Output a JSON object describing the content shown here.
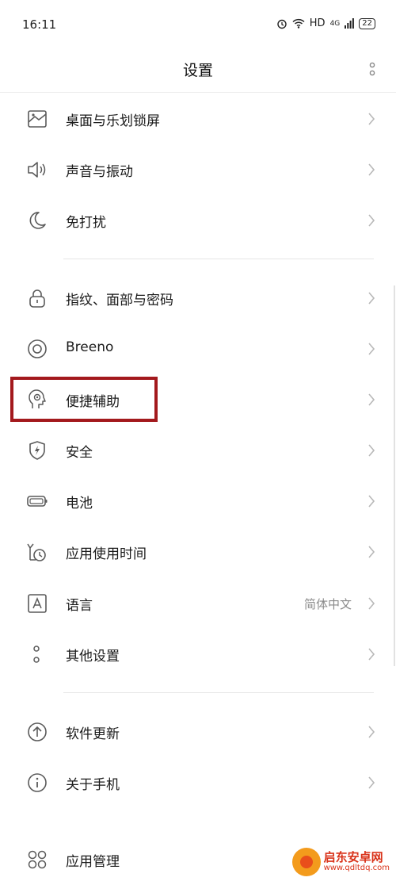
{
  "status_bar": {
    "time": "16:11",
    "network": "HD",
    "signal": "4G",
    "battery": "22"
  },
  "header": {
    "title": "设置"
  },
  "sections": [
    {
      "items": [
        {
          "name": "wallpaper",
          "icon": "wallpaper-icon",
          "label": "桌面与乐划锁屏"
        },
        {
          "name": "sound",
          "icon": "speaker-icon",
          "label": "声音与振动"
        },
        {
          "name": "dnd",
          "icon": "moon-icon",
          "label": "免打扰"
        }
      ]
    },
    {
      "items": [
        {
          "name": "security-lock",
          "icon": "lock-icon",
          "label": "指纹、面部与密码"
        },
        {
          "name": "breeno",
          "icon": "breeno-icon",
          "label": "Breeno"
        },
        {
          "name": "accessibility",
          "icon": "accessibility-icon",
          "label": "便捷辅助",
          "highlighted": true
        },
        {
          "name": "security",
          "icon": "shield-icon",
          "label": "安全"
        },
        {
          "name": "battery",
          "icon": "battery-icon",
          "label": "电池"
        },
        {
          "name": "screen-time",
          "icon": "clock-icon",
          "label": "应用使用时间"
        },
        {
          "name": "language",
          "icon": "language-icon",
          "label": "语言",
          "value": "简体中文"
        },
        {
          "name": "other-settings",
          "icon": "more-vertical-icon",
          "label": "其他设置"
        }
      ]
    },
    {
      "items": [
        {
          "name": "software-update",
          "icon": "arrow-up-icon",
          "label": "软件更新"
        },
        {
          "name": "about-phone",
          "icon": "info-icon",
          "label": "关于手机"
        },
        {
          "name": "app-management",
          "icon": "apps-icon",
          "label": "应用管理"
        }
      ]
    }
  ],
  "watermark": {
    "title": "启东安卓网",
    "url": "www.qdltdq.com"
  },
  "colors": {
    "highlight_border": "#a3191d",
    "icon_stroke": "#5a5a5a",
    "chevron": "#b8b8b8"
  }
}
